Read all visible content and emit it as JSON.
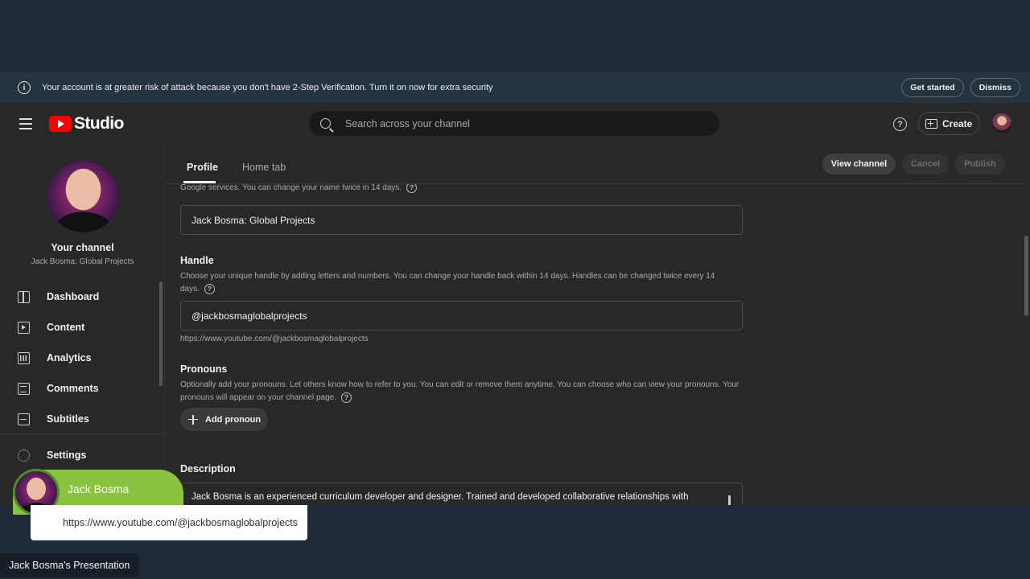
{
  "banner": {
    "message": "Your account is at greater risk of attack because you don't have 2-Step Verification. Turn it on now for extra security",
    "get_started": "Get started",
    "dismiss": "Dismiss"
  },
  "header": {
    "logo_text": "Studio",
    "search_placeholder": "Search across your channel",
    "create_label": "Create",
    "help_glyph": "?"
  },
  "sidebar": {
    "channel_title": "Your channel",
    "channel_name": "Jack Bosma: Global Projects",
    "items": [
      {
        "label": "Dashboard",
        "icon": "dashboard-icon"
      },
      {
        "label": "Content",
        "icon": "content-icon"
      },
      {
        "label": "Analytics",
        "icon": "analytics-icon"
      },
      {
        "label": "Comments",
        "icon": "comments-icon"
      },
      {
        "label": "Subtitles",
        "icon": "subtitles-icon"
      }
    ],
    "settings_label": "Settings"
  },
  "tabs": {
    "profile": "Profile",
    "home": "Home tab"
  },
  "actions": {
    "view_channel": "View channel",
    "cancel": "Cancel",
    "publish": "Publish"
  },
  "form": {
    "name_hint": "Google services. You can change your name twice in 14 days.",
    "name_value": "Jack Bosma: Global Projects",
    "handle_title": "Handle",
    "handle_hint": "Choose your unique handle by adding letters and numbers. You can change your handle back within 14 days. Handles can be changed twice every 14 days.",
    "handle_value": "@jackbosmaglobalprojects",
    "handle_url": "https://www.youtube.com/@jackbosmaglobalprojects",
    "pronouns_title": "Pronouns",
    "pronouns_hint": "Optionally add your pronouns. Let others know how to refer to you. You can edit or remove them anytime. You can choose who can view your pronouns. Your pronouns will appear on your channel page.",
    "add_pronoun": "Add pronoun",
    "description_title": "Description",
    "description_value": "Jack Bosma is an experienced curriculum developer and designer. Trained and developed collaborative relationships with"
  },
  "overlay": {
    "presenter_name": "Jack Bosma",
    "presenter_url": "https://www.youtube.com/@jackbosmaglobalprojects",
    "footer_label": "Jack Bosma's Presentation"
  },
  "colors": {
    "accent_red": "#ff0000",
    "lower_third_green": "#8ac43f"
  }
}
